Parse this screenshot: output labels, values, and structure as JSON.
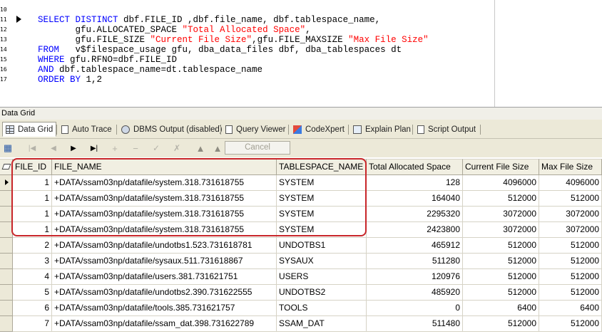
{
  "editor": {
    "line_numbers": [
      "10",
      "11",
      "12",
      "13",
      "14",
      "15",
      "16",
      "17"
    ],
    "sql": {
      "l1": {
        "k1": "SELECT DISTINCT",
        "t1": " dbf.FILE_ID ,dbf.file_name, dbf.tablespace_name,"
      },
      "l2": {
        "t1": "       gfu.ALLOCATED_SPACE ",
        "s1": "\"Total Allocated Space\"",
        "t2": ","
      },
      "l3": {
        "t1": "       gfu.FILE_SIZE ",
        "s1": "\"Current File Size\"",
        "t2": ",gfu.FILE_MAXSIZE ",
        "s2": "\"Max File Size\""
      },
      "l4": {
        "k1": "FROM",
        "t1": "   v$filespace_usage gfu, dba_data_files dbf, dba_tablespaces dt"
      },
      "l5": {
        "k1": "WHERE",
        "t1": " gfu.RFNO=dbf.FILE_ID"
      },
      "l6": {
        "k1": "AND",
        "t1": " dbf.tablespace_name=dt.tablespace_name"
      },
      "l7": {
        "k1": "ORDER BY",
        "t1": " 1,2"
      }
    }
  },
  "panel_title": "Data Grid",
  "tabs": [
    {
      "label": "Data Grid",
      "icon": "grid-icon"
    },
    {
      "label": "Auto Trace",
      "icon": "document-icon"
    },
    {
      "label": "DBMS Output (disabled)",
      "icon": "dbms-icon"
    },
    {
      "label": "Query Viewer",
      "icon": "document-icon"
    },
    {
      "label": "CodeXpert",
      "icon": "codexpert-icon"
    },
    {
      "label": "Explain Plan",
      "icon": "plan-icon"
    },
    {
      "label": "Script Output",
      "icon": "document-icon"
    }
  ],
  "toolbar": {
    "cancel_label": "Cancel"
  },
  "grid": {
    "columns": [
      "FILE_ID",
      "FILE_NAME",
      "TABLESPACE_NAME",
      "Total Allocated Space",
      "Current File Size",
      "Max File Size"
    ],
    "rows": [
      [
        "1",
        "+DATA/ssam03np/datafile/system.318.731618755",
        "SYSTEM",
        "128",
        "4096000",
        "4096000"
      ],
      [
        "1",
        "+DATA/ssam03np/datafile/system.318.731618755",
        "SYSTEM",
        "164040",
        "512000",
        "512000"
      ],
      [
        "1",
        "+DATA/ssam03np/datafile/system.318.731618755",
        "SYSTEM",
        "2295320",
        "3072000",
        "3072000"
      ],
      [
        "1",
        "+DATA/ssam03np/datafile/system.318.731618755",
        "SYSTEM",
        "2423800",
        "3072000",
        "3072000"
      ],
      [
        "2",
        "+DATA/ssam03np/datafile/undotbs1.523.731618781",
        "UNDOTBS1",
        "465912",
        "512000",
        "512000"
      ],
      [
        "3",
        "+DATA/ssam03np/datafile/sysaux.511.731618867",
        "SYSAUX",
        "511280",
        "512000",
        "512000"
      ],
      [
        "4",
        "+DATA/ssam03np/datafile/users.381.731621751",
        "USERS",
        "120976",
        "512000",
        "512000"
      ],
      [
        "5",
        "+DATA/ssam03np/datafile/undotbs2.390.731622555",
        "UNDOTBS2",
        "485920",
        "512000",
        "512000"
      ],
      [
        "6",
        "+DATA/ssam03np/datafile/tools.385.731621757",
        "TOOLS",
        "0",
        "6400",
        "6400"
      ],
      [
        "7",
        "+DATA/ssam03np/datafile/ssam_dat.398.731622789",
        "SSAM_DAT",
        "511480",
        "512000",
        "512000"
      ]
    ]
  },
  "colors": {
    "highlight": "#c8262a",
    "keyword": "#0000ff",
    "string": "#ff0000"
  }
}
